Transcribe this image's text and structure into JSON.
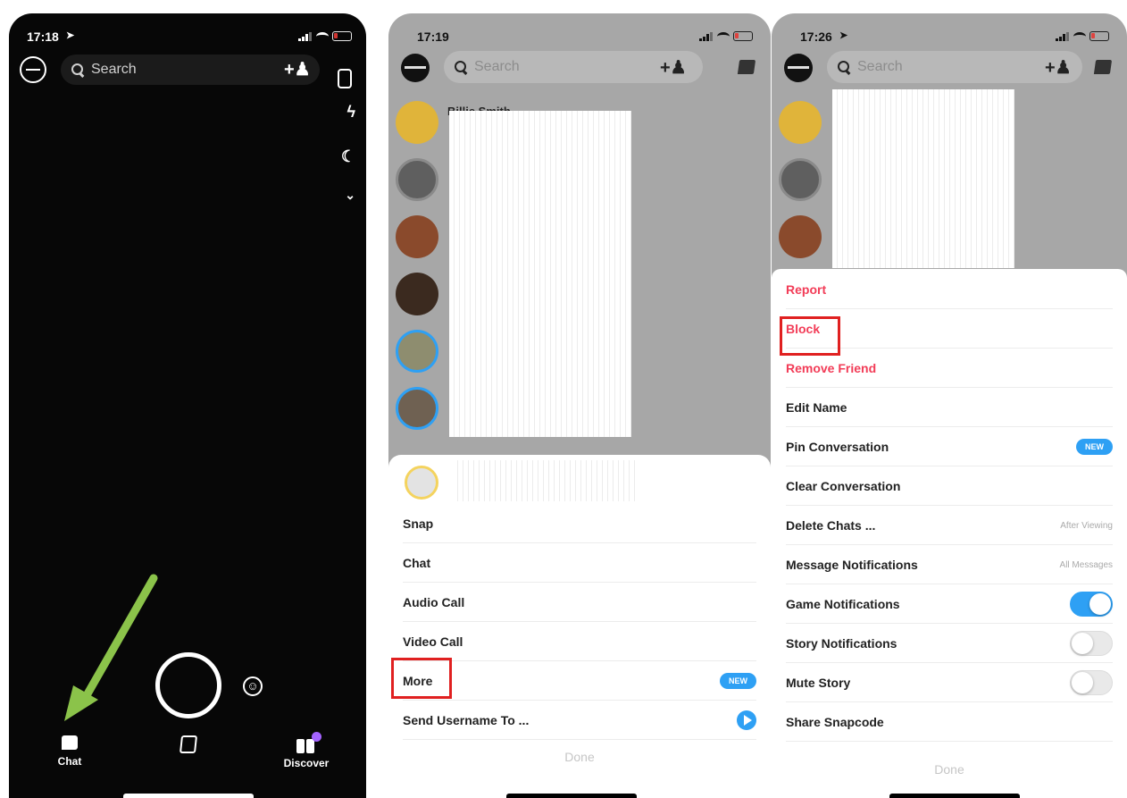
{
  "phone1": {
    "time": "17:18",
    "search_placeholder": "Search",
    "nav": {
      "chat": "Chat",
      "discover": "Discover"
    }
  },
  "phone2": {
    "time": "17:19",
    "search_placeholder": "Search",
    "partial_name": "Billie Smith",
    "menu": {
      "snap": "Snap",
      "chat": "Chat",
      "audio_call": "Audio Call",
      "video_call": "Video Call",
      "more": "More",
      "more_badge": "NEW",
      "send_username": "Send Username To ..."
    },
    "done": "Done"
  },
  "phone3": {
    "time": "17:26",
    "search_placeholder": "Search",
    "menu": {
      "report": "Report",
      "block": "Block",
      "remove_friend": "Remove Friend",
      "edit_name": "Edit Name",
      "pin_conversation": "Pin Conversation",
      "pin_badge": "NEW",
      "clear_conversation": "Clear Conversation",
      "delete_chats": "Delete Chats ...",
      "delete_chats_value": "After Viewing",
      "message_notifications": "Message Notifications",
      "message_notifications_value": "All Messages",
      "game_notifications": "Game Notifications",
      "story_notifications": "Story Notifications",
      "mute_story": "Mute Story",
      "share_snapcode": "Share Snapcode"
    },
    "toggles": {
      "game_notifications": true,
      "story_notifications": false,
      "mute_story": false
    },
    "done": "Done"
  },
  "colors": {
    "snap_red": "#f23c57",
    "accent_blue": "#2ea0f4",
    "highlight": "#e02020",
    "arrow_green": "#8bc34a"
  },
  "icons": [
    "location-arrow-icon",
    "signal-icon",
    "wifi-icon",
    "battery-icon",
    "search-icon",
    "add-friend-icon",
    "flip-camera-icon",
    "flash-icon",
    "night-mode-icon",
    "chevron-down-icon",
    "lens-icon",
    "chat-icon",
    "stories-icon",
    "discover-icon",
    "new-chat-icon",
    "send-icon"
  ]
}
